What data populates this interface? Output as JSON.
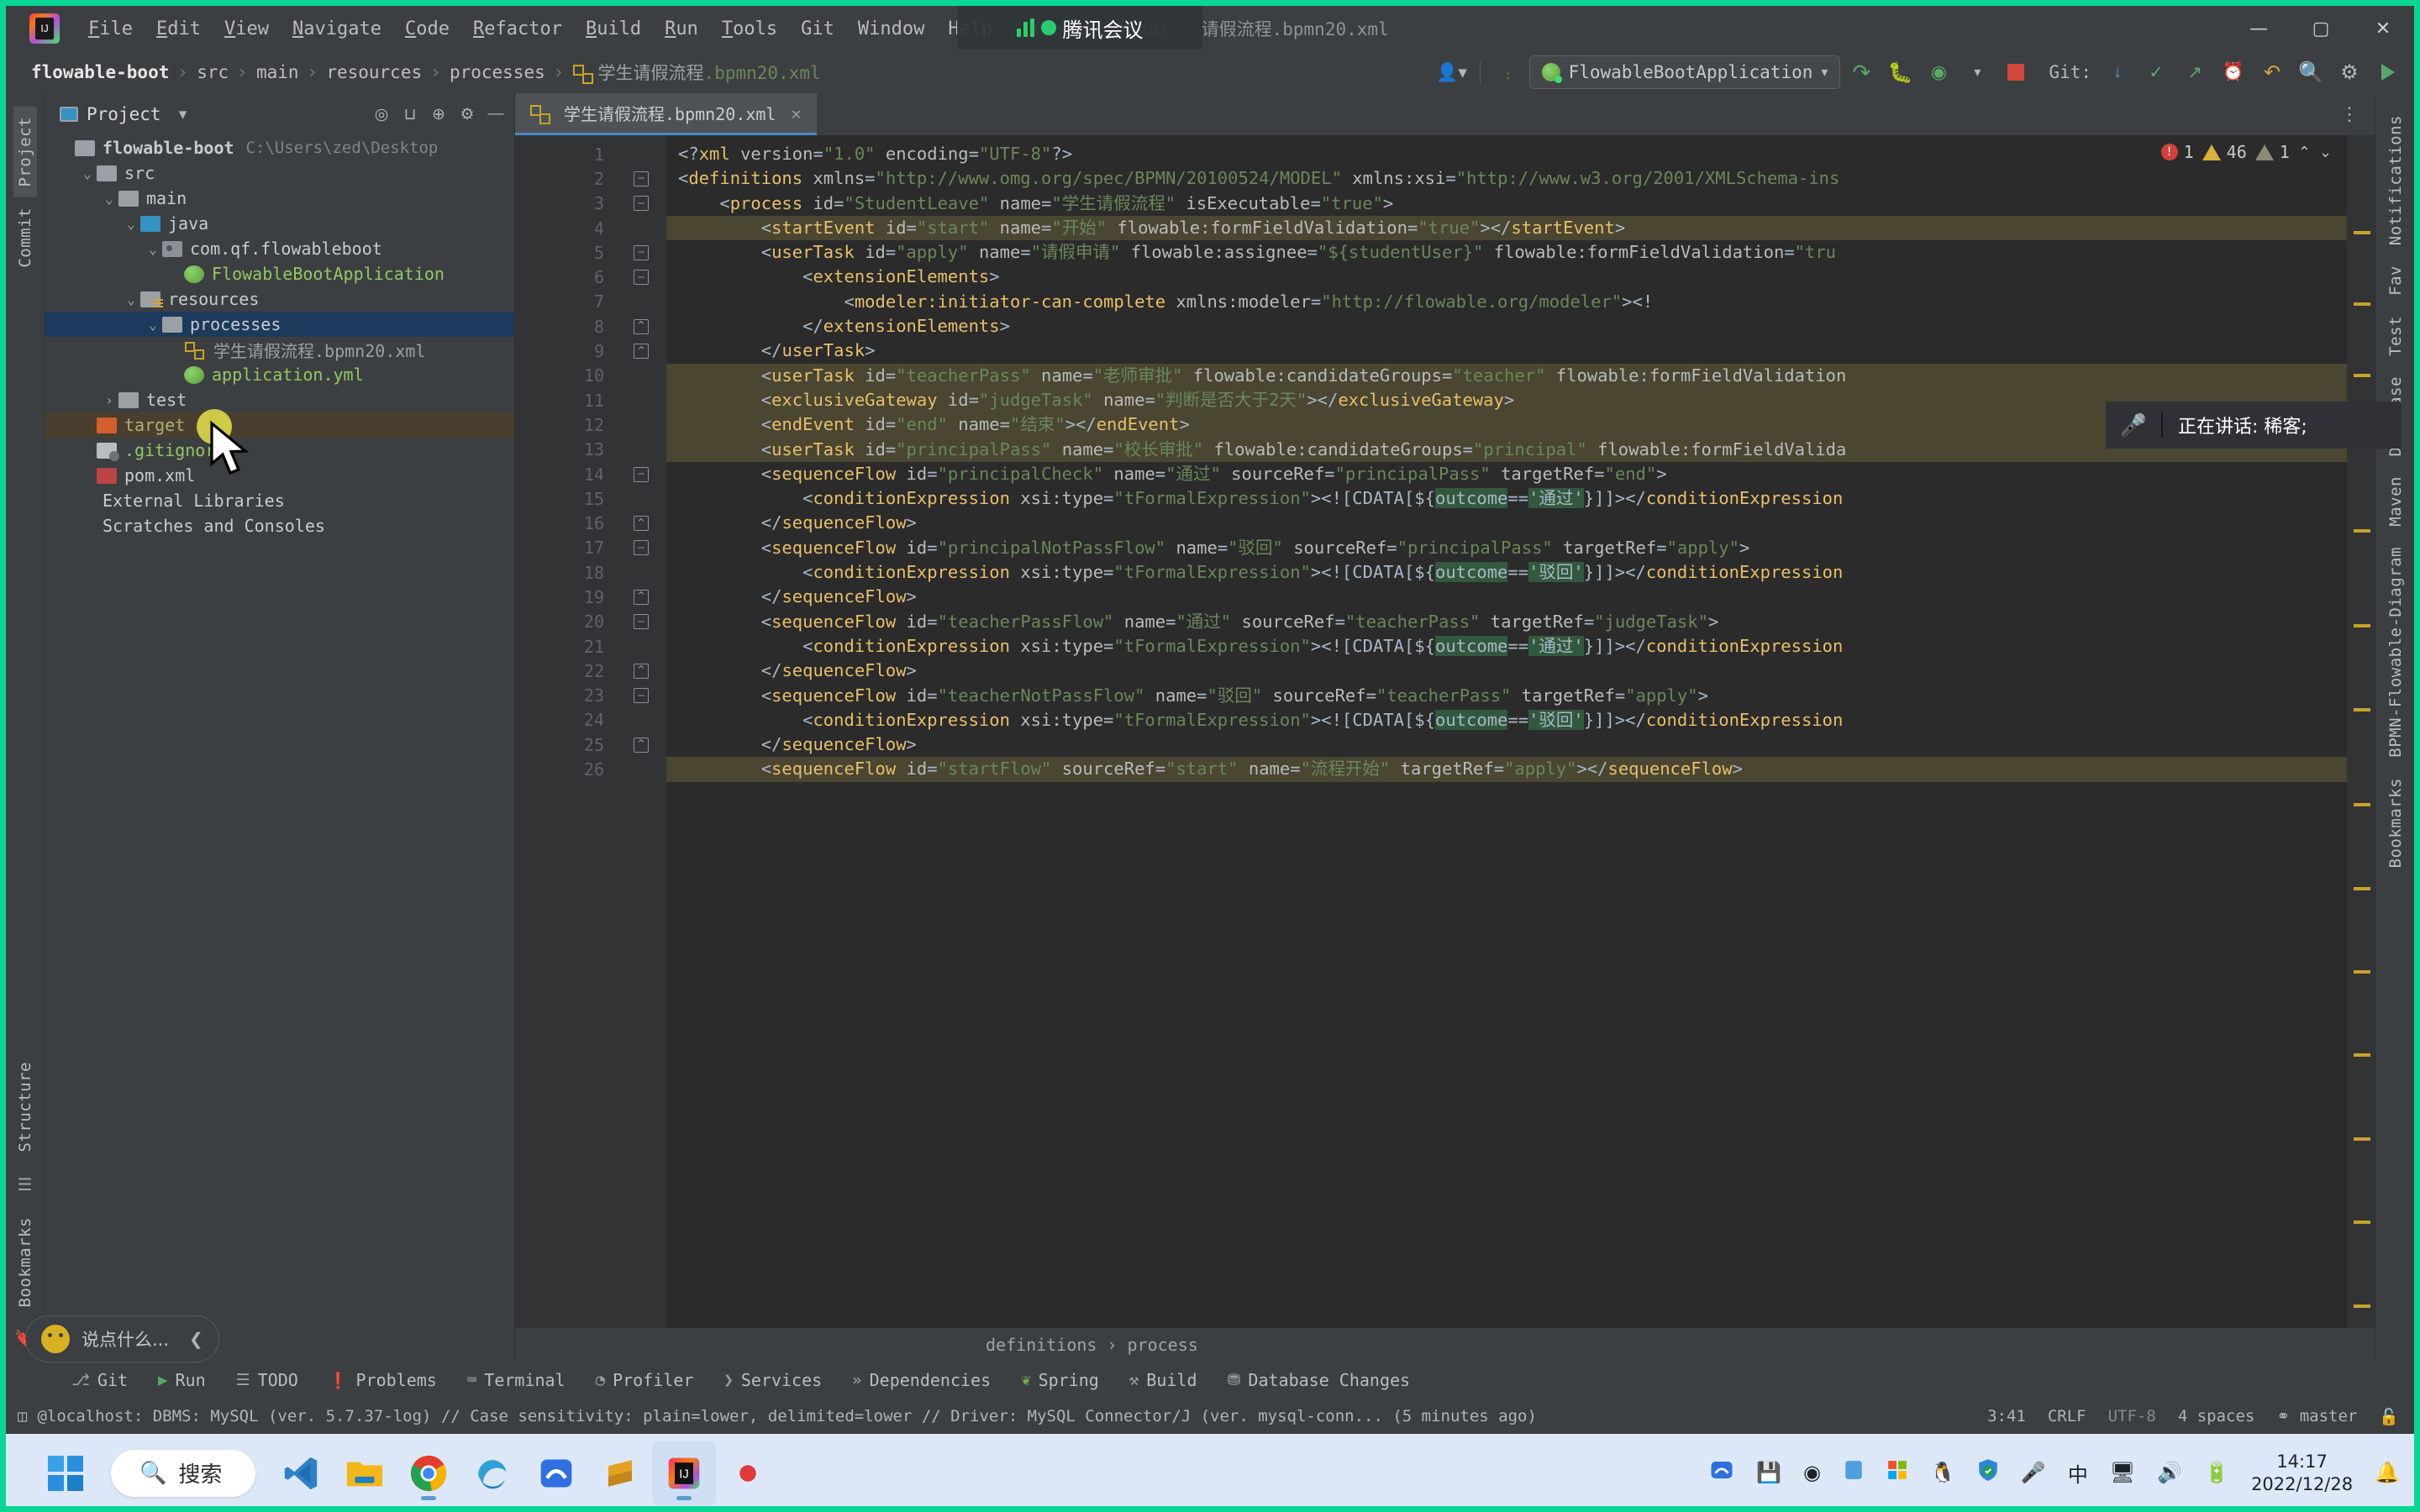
{
  "window": {
    "app_logo": "intellij-idea-logo",
    "title": "flowable-boot",
    "title_suffix": "请假流程.bpmn20.xml",
    "menu": [
      "File",
      "Edit",
      "View",
      "Navigate",
      "Code",
      "Refactor",
      "Build",
      "Run",
      "Tools",
      "Git",
      "Window",
      "Help"
    ],
    "controls": {
      "minimize": "—",
      "maximize": "▢",
      "close": "✕"
    }
  },
  "tencent_overlay": {
    "app_name": "腾讯会议",
    "toast_text": "正在讲话: 稀客;",
    "mic_icon": "microphone-icon",
    "accent": "#2bcc6e"
  },
  "navbar": {
    "breadcrumbs": [
      "flowable-boot",
      "src",
      "main",
      "resources",
      "processes"
    ],
    "file_name": "学生请假流程",
    "file_ext": ".bpmn20.xml",
    "run_config": "FlowableBootApplication",
    "git_label": "Git:",
    "icons": [
      "user-icon",
      "build-hammer-icon",
      "run-icon",
      "debug-icon",
      "coverage-icon",
      "profile-icon",
      "stop-icon",
      "git-update-icon",
      "git-commit-icon",
      "git-push-icon",
      "git-history-icon",
      "undo-icon",
      "search-icon",
      "settings-icon"
    ]
  },
  "left_stripe": {
    "tabs": [
      "Project",
      "Commit"
    ],
    "selected": "Project"
  },
  "right_stripe": {
    "tabs": [
      "Notifications",
      "Fav",
      "Test",
      "Database",
      "Maven",
      "BPMN-Flowable-Diagram",
      "Bookmarks"
    ]
  },
  "project_panel": {
    "title": "Project",
    "toolbar_icons": [
      "locate-icon",
      "expand-all-icon",
      "collapse-all-icon",
      "gear-icon",
      "hide-icon"
    ],
    "tree": [
      {
        "label": "flowable-boot",
        "path": "C:\\Users\\zed\\Desktop",
        "depth": 0,
        "arrow": "",
        "icon": "module-icon",
        "style": "root"
      },
      {
        "label": "src",
        "depth": 1,
        "arrow": "v",
        "icon": "folder-icon",
        "style": "normal"
      },
      {
        "label": "main",
        "depth": 2,
        "arrow": "v",
        "icon": "folder-icon",
        "style": "normal"
      },
      {
        "label": "java",
        "depth": 3,
        "arrow": "v",
        "icon": "source-folder-icon",
        "style": "normal"
      },
      {
        "label": "com.qf.flowableboot",
        "depth": 4,
        "arrow": "v",
        "icon": "package-icon",
        "style": "normal"
      },
      {
        "label": "FlowableBootApplication",
        "depth": 5,
        "arrow": "",
        "icon": "spring-boot-class-icon",
        "style": "green"
      },
      {
        "label": "resources",
        "depth": 3,
        "arrow": "v",
        "icon": "resource-folder-icon",
        "style": "normal"
      },
      {
        "label": "processes",
        "depth": 4,
        "arrow": "v",
        "icon": "folder-icon",
        "style": "selected"
      },
      {
        "label": "学生请假流程.bpmn20.xml",
        "depth": 5,
        "arrow": "",
        "icon": "bpmn-file-icon",
        "style": "dim"
      },
      {
        "label": "application.yml",
        "depth": 5,
        "arrow": "",
        "icon": "spring-yml-icon",
        "style": "green"
      },
      {
        "label": "test",
        "depth": 2,
        "arrow": ">",
        "icon": "folder-icon",
        "style": "normal"
      },
      {
        "label": "target",
        "depth": 1,
        "arrow": "",
        "icon": "excluded-folder-icon",
        "style": "target"
      },
      {
        "label": ".gitignore",
        "depth": 1,
        "arrow": "",
        "icon": "gitignore-icon",
        "style": "green"
      },
      {
        "label": "pom.xml",
        "depth": 1,
        "arrow": "",
        "icon": "maven-icon",
        "style": "normal"
      },
      {
        "label": "External Libraries",
        "depth": 0,
        "arrow": "",
        "icon": "library-icon",
        "style": "normal"
      },
      {
        "label": "Scratches and Consoles",
        "depth": 0,
        "arrow": "",
        "icon": "scratch-icon",
        "style": "normal"
      }
    ]
  },
  "editor": {
    "tab": {
      "label": "学生请假流程.bpmn20.xml",
      "icon": "bpmn-file-icon",
      "close": "✕"
    },
    "inspections": {
      "errors": "1",
      "warnings": "46",
      "weak_warnings": "1",
      "up": "⌃",
      "down": "⌄"
    },
    "breadcrumb": [
      "definitions",
      "process"
    ],
    "first_line": 1,
    "lines": [
      {
        "n": 1,
        "fold": "",
        "hl": false,
        "html": "<span class=\"punct\">&lt;?</span><span class=\"tag\">xml</span> <span class=\"attr\">version</span><span class=\"punct\">=</span><span class=\"valq\">\"1.0\"</span> <span class=\"attr\">encoding</span><span class=\"punct\">=</span><span class=\"valq\">\"UTF-8\"</span><span class=\"punct\">?&gt;</span>"
      },
      {
        "n": 2,
        "fold": "-",
        "hl": false,
        "html": "<span class=\"punct\">&lt;</span><span class=\"tag\">definitions</span> <span class=\"attr\">xmlns</span><span class=\"punct\">=</span><span class=\"valq\">\"http://www.omg.org/spec/BPMN/20100524/MODEL\"</span> <span class=\"attr\">xmlns:xsi</span><span class=\"punct\">=</span><span class=\"valq\">\"http://www.w3.org/2001/XMLSchema-ins</span>"
      },
      {
        "n": 3,
        "fold": "-",
        "hl": false,
        "html": "    <span class=\"punct\">&lt;</span><span class=\"tag\">process</span> <span class=\"attr\">id</span><span class=\"punct\">=</span><span class=\"valq\">\"StudentLeave\"</span> <span class=\"attr\">name</span><span class=\"punct\">=</span><span class=\"valq\">\"学生请假流程\"</span> <span class=\"attr\">isExecutable</span><span class=\"punct\">=</span><span class=\"valq\">\"true\"</span><span class=\"punct\">&gt;</span>"
      },
      {
        "n": 4,
        "fold": "",
        "hl": true,
        "html": "        <span class=\"punct\">&lt;</span><span class=\"tag\">startEvent</span> <span class=\"attr\">id</span><span class=\"punct\">=</span><span class=\"valq\">\"start\"</span> <span class=\"attr\">name</span><span class=\"punct\">=</span><span class=\"valq\">\"开始\"</span> <span class=\"attr\">flowable:formFieldValidation</span><span class=\"punct\">=</span><span class=\"valq\">\"true\"</span><span class=\"punct\">&gt;&lt;/</span><span class=\"tag\">startEvent</span><span class=\"punct\">&gt;</span>"
      },
      {
        "n": 5,
        "fold": "-",
        "hl": false,
        "html": "        <span class=\"punct\">&lt;</span><span class=\"tag\">userTask</span> <span class=\"attr\">id</span><span class=\"punct\">=</span><span class=\"valq\">\"apply\"</span> <span class=\"attr\">name</span><span class=\"punct\">=</span><span class=\"valq\">\"请假申请\"</span> <span class=\"attr\">flowable:assignee</span><span class=\"punct\">=</span><span class=\"valq\">\"${studentUser}\"</span> <span class=\"attr\">flowable:formFieldValidation</span><span class=\"punct\">=</span><span class=\"valq\">\"tru</span>"
      },
      {
        "n": 6,
        "fold": "-",
        "hl": false,
        "html": "            <span class=\"punct\">&lt;</span><span class=\"tag\">extensionElements</span><span class=\"punct\">&gt;</span>"
      },
      {
        "n": 7,
        "fold": "",
        "hl": false,
        "html": "                <span class=\"punct\">&lt;</span><span class=\"tag\">modeler:initiator-can-complete</span> <span class=\"attr\">xmlns:modeler</span><span class=\"punct\">=</span><span class=\"valq\">\"http://flowable.org/modeler\"</span><span class=\"punct\">&gt;&lt;!</span>"
      },
      {
        "n": 8,
        "fold": "⌃",
        "hl": false,
        "html": "            <span class=\"punct\">&lt;/</span><span class=\"tag\">extensionElements</span><span class=\"punct\">&gt;</span>"
      },
      {
        "n": 9,
        "fold": "⌃",
        "hl": false,
        "html": "        <span class=\"punct\">&lt;/</span><span class=\"tag\">userTask</span><span class=\"punct\">&gt;</span>"
      },
      {
        "n": 10,
        "fold": "",
        "hl": true,
        "html": "        <span class=\"punct\">&lt;</span><span class=\"tag\">userTask</span> <span class=\"attr\">id</span><span class=\"punct\">=</span><span class=\"valq\">\"teacherPass\"</span> <span class=\"attr\">name</span><span class=\"punct\">=</span><span class=\"valq\">\"老师审批\"</span> <span class=\"attr\">flowable:candidateGroups</span><span class=\"punct\">=</span><span class=\"valq\">\"teacher\"</span> <span class=\"attr\">flowable:formFieldValidation</span>"
      },
      {
        "n": 11,
        "fold": "",
        "hl": true,
        "html": "        <span class=\"punct\">&lt;</span><span class=\"tag\">exclusiveGateway</span> <span class=\"attr\">id</span><span class=\"punct\">=</span><span class=\"valq\">\"judgeTask\"</span> <span class=\"attr\">name</span><span class=\"punct\">=</span><span class=\"valq\">\"判断是否大于2天\"</span><span class=\"punct\">&gt;&lt;/</span><span class=\"tag\">exclusiveGateway</span><span class=\"punct\">&gt;</span>"
      },
      {
        "n": 12,
        "fold": "",
        "hl": true,
        "html": "        <span class=\"punct\">&lt;</span><span class=\"tag\">endEvent</span> <span class=\"attr\">id</span><span class=\"punct\">=</span><span class=\"valq\">\"end\"</span> <span class=\"attr\">name</span><span class=\"punct\">=</span><span class=\"valq\">\"结束\"</span><span class=\"punct\">&gt;&lt;/</span><span class=\"tag\">endEvent</span><span class=\"punct\">&gt;</span>"
      },
      {
        "n": 13,
        "fold": "",
        "hl": true,
        "html": "        <span class=\"punct\">&lt;</span><span class=\"tag\">userTask</span> <span class=\"attr\">id</span><span class=\"punct\">=</span><span class=\"valq\">\"principalPass\"</span> <span class=\"attr\">name</span><span class=\"punct\">=</span><span class=\"valq\">\"校长审批\"</span> <span class=\"attr\">flowable:candidateGroups</span><span class=\"punct\">=</span><span class=\"valq\">\"principal\"</span> <span class=\"attr\">flowable:formFieldValida</span>"
      },
      {
        "n": 14,
        "fold": "-",
        "hl": false,
        "html": "        <span class=\"punct\">&lt;</span><span class=\"tag\">sequenceFlow</span> <span class=\"attr\">id</span><span class=\"punct\">=</span><span class=\"valq\">\"principalCheck\"</span> <span class=\"attr\">name</span><span class=\"punct\">=</span><span class=\"valq\">\"通过\"</span> <span class=\"attr\">sourceRef</span><span class=\"punct\">=</span><span class=\"valq\">\"principalPass\"</span> <span class=\"attr\">targetRef</span><span class=\"punct\">=</span><span class=\"valq\">\"end\"</span><span class=\"punct\">&gt;</span>"
      },
      {
        "n": 15,
        "fold": "",
        "hl": false,
        "html": "            <span class=\"punct\">&lt;</span><span class=\"tag\">conditionExpression</span> <span class=\"attr\">xsi:type</span><span class=\"punct\">=</span><span class=\"valq\">\"tFormalExpression\"</span><span class=\"punct\">&gt;&lt;![CDATA[${</span><span class=\"hlmark\">outcome</span><span class=\"punct\">==</span><span class=\"hlmark\">'通过'</span><span class=\"punct\">}]]&gt;&lt;/</span><span class=\"tag\">conditionExpression</span>"
      },
      {
        "n": 16,
        "fold": "⌃",
        "hl": false,
        "html": "        <span class=\"punct\">&lt;/</span><span class=\"tag\">sequenceFlow</span><span class=\"punct\">&gt;</span>"
      },
      {
        "n": 17,
        "fold": "-",
        "hl": false,
        "html": "        <span class=\"punct\">&lt;</span><span class=\"tag\">sequenceFlow</span> <span class=\"attr\">id</span><span class=\"punct\">=</span><span class=\"valq\">\"principalNotPassFlow\"</span> <span class=\"attr\">name</span><span class=\"punct\">=</span><span class=\"valq\">\"驳回\"</span> <span class=\"attr\">sourceRef</span><span class=\"punct\">=</span><span class=\"valq\">\"principalPass\"</span> <span class=\"attr\">targetRef</span><span class=\"punct\">=</span><span class=\"valq\">\"apply\"</span><span class=\"punct\">&gt;</span>"
      },
      {
        "n": 18,
        "fold": "",
        "hl": false,
        "html": "            <span class=\"punct\">&lt;</span><span class=\"tag\">conditionExpression</span> <span class=\"attr\">xsi:type</span><span class=\"punct\">=</span><span class=\"valq\">\"tFormalExpression\"</span><span class=\"punct\">&gt;&lt;![CDATA[${</span><span class=\"hlmark\">outcome</span><span class=\"punct\">==</span><span class=\"hlmark\">'驳回'</span><span class=\"punct\">}]]&gt;&lt;/</span><span class=\"tag\">conditionExpression</span>"
      },
      {
        "n": 19,
        "fold": "⌃",
        "hl": false,
        "html": "        <span class=\"punct\">&lt;/</span><span class=\"tag\">sequenceFlow</span><span class=\"punct\">&gt;</span>"
      },
      {
        "n": 20,
        "fold": "-",
        "hl": false,
        "html": "        <span class=\"punct\">&lt;</span><span class=\"tag\">sequenceFlow</span> <span class=\"attr\">id</span><span class=\"punct\">=</span><span class=\"valq\">\"teacherPassFlow\"</span> <span class=\"attr\">name</span><span class=\"punct\">=</span><span class=\"valq\">\"通过\"</span> <span class=\"attr\">sourceRef</span><span class=\"punct\">=</span><span class=\"valq\">\"teacherPass\"</span> <span class=\"attr\">targetRef</span><span class=\"punct\">=</span><span class=\"valq\">\"judgeTask\"</span><span class=\"punct\">&gt;</span>"
      },
      {
        "n": 21,
        "fold": "",
        "hl": false,
        "html": "            <span class=\"punct\">&lt;</span><span class=\"tag\">conditionExpression</span> <span class=\"attr\">xsi:type</span><span class=\"punct\">=</span><span class=\"valq\">\"tFormalExpression\"</span><span class=\"punct\">&gt;&lt;![CDATA[${</span><span class=\"hlmark\">outcome</span><span class=\"punct\">==</span><span class=\"hlmark\">'通过'</span><span class=\"punct\">}]]&gt;&lt;/</span><span class=\"tag\">conditionExpression</span>"
      },
      {
        "n": 22,
        "fold": "⌃",
        "hl": false,
        "html": "        <span class=\"punct\">&lt;/</span><span class=\"tag\">sequenceFlow</span><span class=\"punct\">&gt;</span>"
      },
      {
        "n": 23,
        "fold": "-",
        "hl": false,
        "html": "        <span class=\"punct\">&lt;</span><span class=\"tag\">sequenceFlow</span> <span class=\"attr\">id</span><span class=\"punct\">=</span><span class=\"valq\">\"teacherNotPassFlow\"</span> <span class=\"attr\">name</span><span class=\"punct\">=</span><span class=\"valq\">\"驳回\"</span> <span class=\"attr\">sourceRef</span><span class=\"punct\">=</span><span class=\"valq\">\"teacherPass\"</span> <span class=\"attr\">targetRef</span><span class=\"punct\">=</span><span class=\"valq\">\"apply\"</span><span class=\"punct\">&gt;</span>"
      },
      {
        "n": 24,
        "fold": "",
        "hl": false,
        "html": "            <span class=\"punct\">&lt;</span><span class=\"tag\">conditionExpression</span> <span class=\"attr\">xsi:type</span><span class=\"punct\">=</span><span class=\"valq\">\"tFormalExpression\"</span><span class=\"punct\">&gt;&lt;![CDATA[${</span><span class=\"hlmark\">outcome</span><span class=\"punct\">==</span><span class=\"hlmark\">'驳回'</span><span class=\"punct\">}]]&gt;&lt;/</span><span class=\"tag\">conditionExpression</span>"
      },
      {
        "n": 25,
        "fold": "⌃",
        "hl": false,
        "html": "        <span class=\"punct\">&lt;/</span><span class=\"tag\">sequenceFlow</span><span class=\"punct\">&gt;</span>"
      },
      {
        "n": 26,
        "fold": "",
        "hl": true,
        "html": "        <span class=\"punct\">&lt;</span><span class=\"tag\">sequenceFlow</span> <span class=\"attr\">id</span><span class=\"punct\">=</span><span class=\"valq\">\"startFlow\"</span> <span class=\"attr\">sourceRef</span><span class=\"punct\">=</span><span class=\"valq\">\"start\"</span> <span class=\"attr\">name</span><span class=\"punct\">=</span><span class=\"valq\">\"流程开始\"</span> <span class=\"attr\">targetRef</span><span class=\"punct\">=</span><span class=\"valq\">\"apply\"</span><span class=\"punct\">&gt;&lt;/</span><span class=\"tag\">sequenceFlow</span><span class=\"punct\">&gt;</span>"
      }
    ]
  },
  "tool_windows": [
    {
      "label": "Git",
      "icon": "git-branch-icon"
    },
    {
      "label": "Run",
      "icon": "run-icon"
    },
    {
      "label": "TODO",
      "icon": "todo-list-icon"
    },
    {
      "label": "Problems",
      "icon": "problems-icon"
    },
    {
      "label": "Terminal",
      "icon": "terminal-icon"
    },
    {
      "label": "Profiler",
      "icon": "profiler-icon"
    },
    {
      "label": "Services",
      "icon": "services-icon"
    },
    {
      "label": "Dependencies",
      "icon": "dependencies-icon"
    },
    {
      "label": "Spring",
      "icon": "spring-leaf-icon"
    },
    {
      "label": "Build",
      "icon": "build-hammer-icon"
    },
    {
      "label": "Database Changes",
      "icon": "database-changes-icon"
    }
  ],
  "statusbar": {
    "message": "@localhost: DBMS: MySQL (ver. 5.7.37-log) // Case sensitivity: plain=lower, delimited=lower // Driver: MySQL Connector/J (ver. mysql-conn... (5 minutes ago)",
    "caret": "3:41",
    "line_sep": "CRLF",
    "encoding": "UTF-8",
    "indent": "4 spaces",
    "branch": "master",
    "lock_icon": "unlocked-icon"
  },
  "assistant": {
    "placeholder": "说点什么...",
    "collapse_icon": "chevron-left-icon",
    "avatar": "smiley-icon"
  },
  "taskbar": {
    "start_icon": "windows-start-icon",
    "search_placeholder": "搜索",
    "search_icon": "search-icon",
    "apps": [
      {
        "name": "vscode-icon",
        "color": "#2f80c8"
      },
      {
        "name": "file-explorer-icon",
        "color": "#f2b718"
      },
      {
        "name": "chrome-icon",
        "color": "#4285f4"
      },
      {
        "name": "edge-icon",
        "color": "#0f7ec0"
      },
      {
        "name": "feishu-icon",
        "color": "#2f6fe0"
      },
      {
        "name": "sublime-icon",
        "color": "#e6a020"
      },
      {
        "name": "idea-icon",
        "color": "#f36f2c"
      },
      {
        "name": "record-icon",
        "color": "#e03a3a"
      }
    ],
    "tray": [
      "cloud-icon",
      "usb-icon",
      "disc-icon",
      "app-icon",
      "ms-office-icon",
      "qq-icon",
      "security-icon",
      "microphone-icon",
      "ime-cn-icon",
      "network-icon",
      "volume-icon",
      "battery-icon"
    ],
    "time": "14:17",
    "date": "2022/12/28",
    "notification_icon": "bell-dnd-icon"
  }
}
